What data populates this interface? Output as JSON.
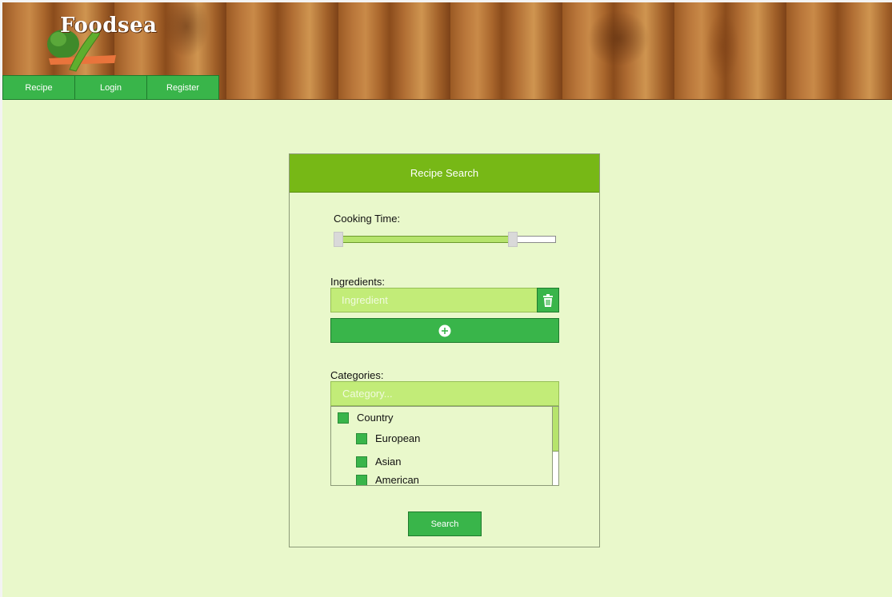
{
  "app": {
    "logo_text": "Foodsea"
  },
  "nav": {
    "items": [
      {
        "label": "Recipe"
      },
      {
        "label": "Login"
      },
      {
        "label": "Register"
      }
    ]
  },
  "search_card": {
    "title": "Recipe Search",
    "cooking_time": {
      "label": "Cooking Time:",
      "range_min_fraction": 0.0,
      "range_max_fraction": 0.78
    },
    "ingredients": {
      "label": "Ingredients:",
      "placeholder": "Ingredient",
      "delete_icon": "trash-icon",
      "add_icon": "plus-circle-icon"
    },
    "categories": {
      "label": "Categories:",
      "placeholder": "Category...",
      "items": [
        {
          "label": "Country",
          "level": 0,
          "checked": true
        },
        {
          "label": "European",
          "level": 1,
          "checked": true
        },
        {
          "label": "Asian",
          "level": 1,
          "checked": true
        },
        {
          "label": "American",
          "level": 1,
          "checked": true
        }
      ]
    },
    "search_label": "Search"
  },
  "colors": {
    "background": "#e9f8cb",
    "header_green": "#77b816",
    "button_green": "#39b54a",
    "input_green": "#c2ec78"
  }
}
